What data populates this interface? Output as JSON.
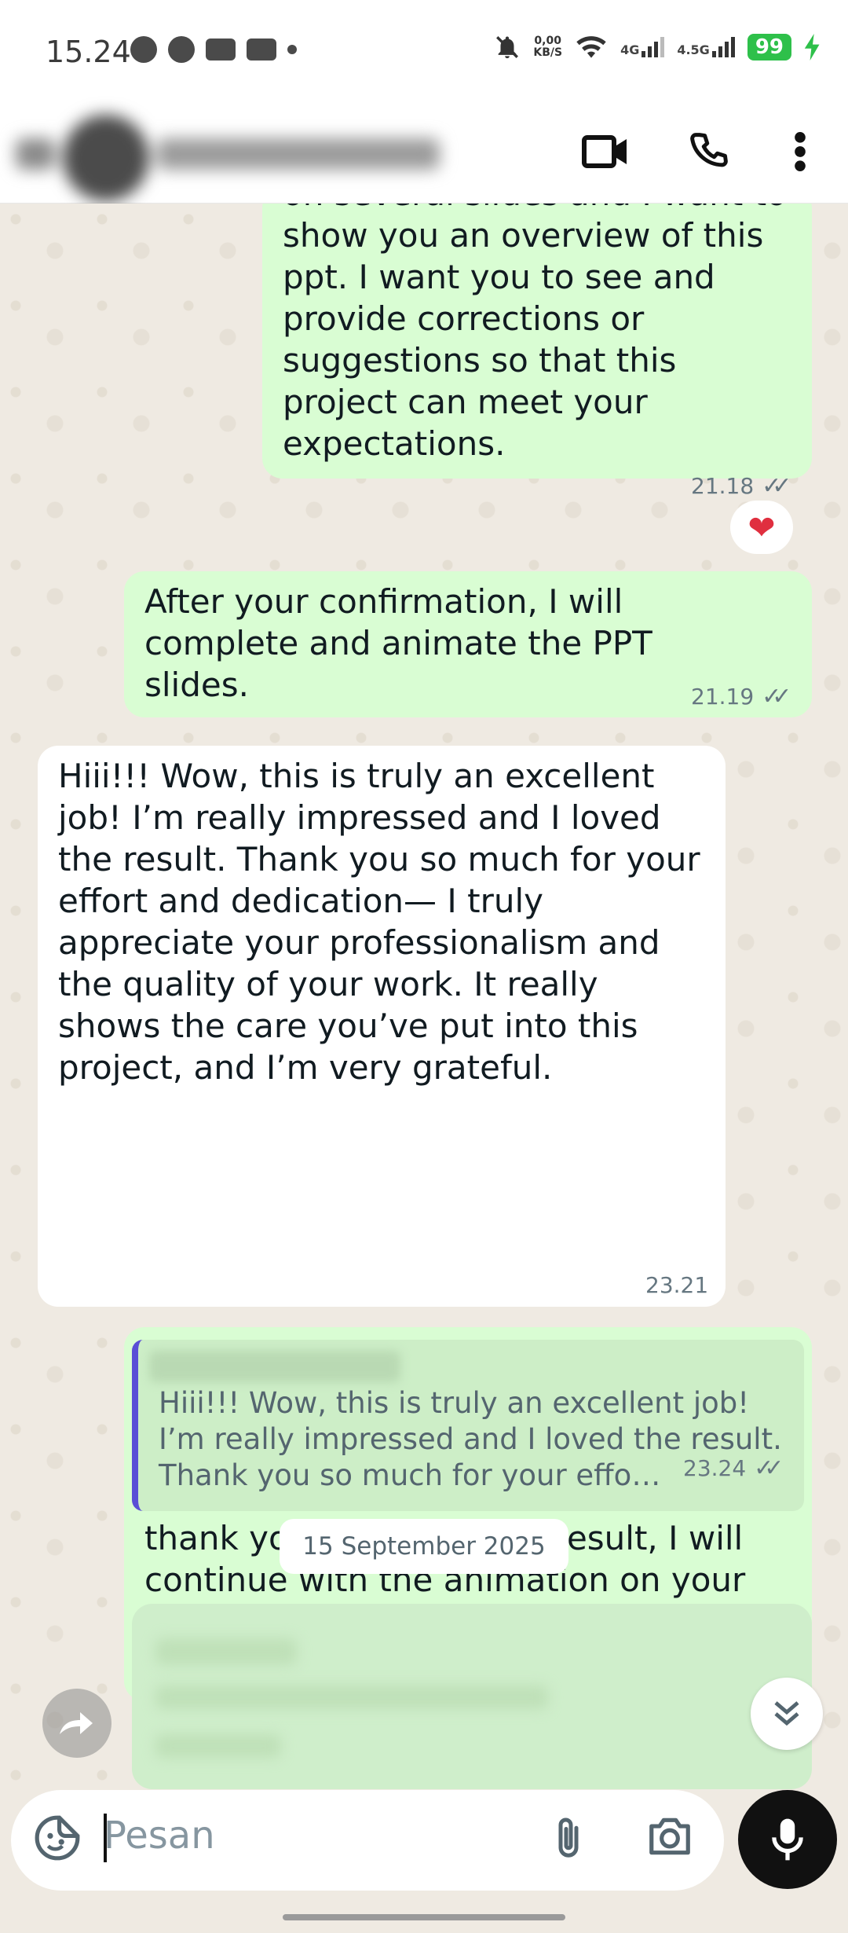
{
  "status_bar": {
    "time": "15.24",
    "net_speed_value": "0,00",
    "net_speed_unit": "KB/S",
    "signal1": "4G",
    "signal2": "4.5G",
    "battery": "99"
  },
  "messages": [
    {
      "text": "on several slides and I want to show you an overview of this ppt. I want you to see and provide corrections or suggestions so that this project can meet your expectations.",
      "time": "21.18",
      "reaction": "❤"
    },
    {
      "text": "After your confirmation, I will complete and animate the PPT slides.",
      "time": "21.19"
    },
    {
      "text": "Hiii!!! Wow, this is truly an excellent job! I’m really impressed and I loved the result. Thank you so much for your effort and dedication— I truly appreciate your professionalism and the quality of your work. It really shows the care you’ve put into this project, and I’m very grateful.",
      "time": "23.21"
    },
    {
      "quote": "Hiii!!! Wow, this is truly an excellent job! I’m really impressed and I loved the result. Thank you so much for your effo…",
      "text": "thank you if you like the result, I will continue with the animation on your ppt. tomorrow your ppt will probably be finished",
      "time": "23.24"
    }
  ],
  "date_separator": "15 September 2025",
  "input": {
    "placeholder": "Pesan"
  },
  "icons": {
    "header": [
      "video-call-icon",
      "voice-call-icon",
      "more-options-icon"
    ],
    "input": [
      "sticker-icon",
      "attach-icon",
      "camera-icon",
      "mic-icon"
    ],
    "floating": [
      "forward-icon",
      "scroll-down-icon"
    ]
  },
  "colors": {
    "outgoing_bubble": "#d9fdd3",
    "incoming_bubble": "#ffffff",
    "chat_bg": "#efeae2",
    "quote_bar": "#5a4ed6",
    "battery": "#2ec04a"
  }
}
